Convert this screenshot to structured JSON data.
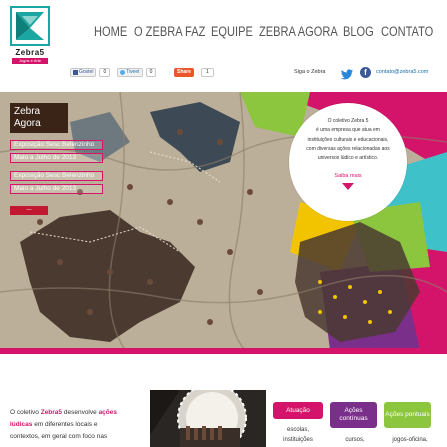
{
  "logo": {
    "name": "Zebra5",
    "tagline": "Jogos e Arte"
  },
  "nav": {
    "items": [
      "HOME",
      "O ZEBRA FAZ",
      "EQUIPE",
      "ZEBRA AGORA",
      "BLOG",
      "CONTATO"
    ]
  },
  "social": {
    "fb_label": "Gostei",
    "fb_count": "0",
    "tw_label": "Tweet",
    "tw_count": "0",
    "share_label": "Share",
    "share_count": "1",
    "follow": "Siga o Zebra",
    "email": "contato@zebra5.com"
  },
  "banner": {
    "heading_line1": "Zebra",
    "heading_line2": "Agora",
    "events": [
      "Exposição Sesc Belenzinho",
      "Maio a Julho de 2013",
      "Exposição Sesc Belenzinho",
      "Maio a Julho de 2013"
    ],
    "prev_label": "—",
    "info_lines": [
      "O coletivo Zebra 5",
      "é uma empresa que atua em",
      "instituições culturais e educacionais,",
      "com diversas ações relacionadas aos",
      "universos lúdico e artístico."
    ],
    "info_more": "Saiba mais"
  },
  "bottom": {
    "text_part1": "O coletivo",
    "text_brand": "Zebra5",
    "text_part2": "desenvolve",
    "text_hl1": "ações",
    "text_hl2": "lúdicas",
    "text_part3": "em diferentes locais e",
    "text_part4": "contextos, em geral com foco nas"
  },
  "categories": [
    {
      "label": "Atuação",
      "color": "#d4146a"
    },
    {
      "label": "Ações contínuas",
      "color": "#7a2f8a"
    },
    {
      "label": "Ações pontuais",
      "color": "#8cc63f"
    }
  ],
  "category_subs": [
    "escolas,",
    "instituições",
    "cursos,",
    "jogos-oficina,"
  ],
  "colors": {
    "accent": "#d4146a",
    "teal": "#1aa6a1",
    "purple": "#7a2f8a",
    "green": "#8cc63f",
    "yellow": "#f2c400",
    "cyan": "#3fc1c9"
  }
}
